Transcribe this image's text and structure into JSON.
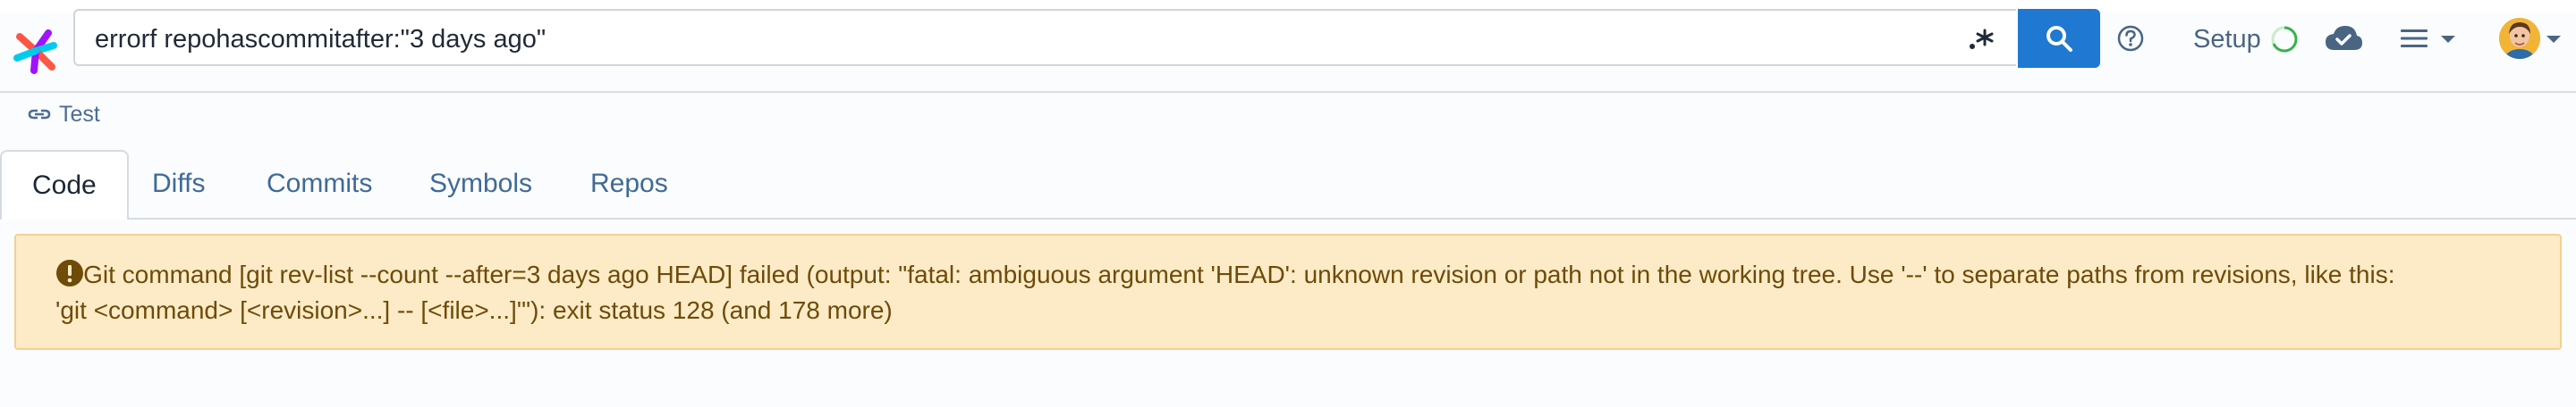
{
  "search": {
    "query": "errorf repohascommitafter:\"3 days ago\"",
    "regex_toggle_label": ".*"
  },
  "header": {
    "setup_label": "Setup"
  },
  "breadcrumb": {
    "test_label": "Test"
  },
  "tabs": [
    {
      "label": "Code",
      "active": true
    },
    {
      "label": "Diffs",
      "active": false
    },
    {
      "label": "Commits",
      "active": false
    },
    {
      "label": "Symbols",
      "active": false
    },
    {
      "label": "Repos",
      "active": false
    }
  ],
  "alert": {
    "line1": "Git command [git rev-list --count --after=3 days ago HEAD] failed (output: \"fatal: ambiguous argument 'HEAD': unknown revision or path not in the working tree. Use '--' to separate paths from revisions, like this:",
    "line2": "'git <command> [<revision>...] -- [<file>...]'\"): exit status 128 (and 178 more)"
  },
  "colors": {
    "accent": "#1f78d1",
    "alert_bg": "#fdebc8",
    "alert_border": "#f3cf91",
    "alert_text": "#6e4b08",
    "link": "#4b6c93"
  },
  "icons": [
    "logo-icon",
    "regex-toggle-icon",
    "search-icon",
    "help-icon",
    "setup-status-icon",
    "cloud-icon",
    "menu-icon",
    "chevron-down-icon",
    "avatar",
    "link-icon",
    "alert-icon"
  ]
}
